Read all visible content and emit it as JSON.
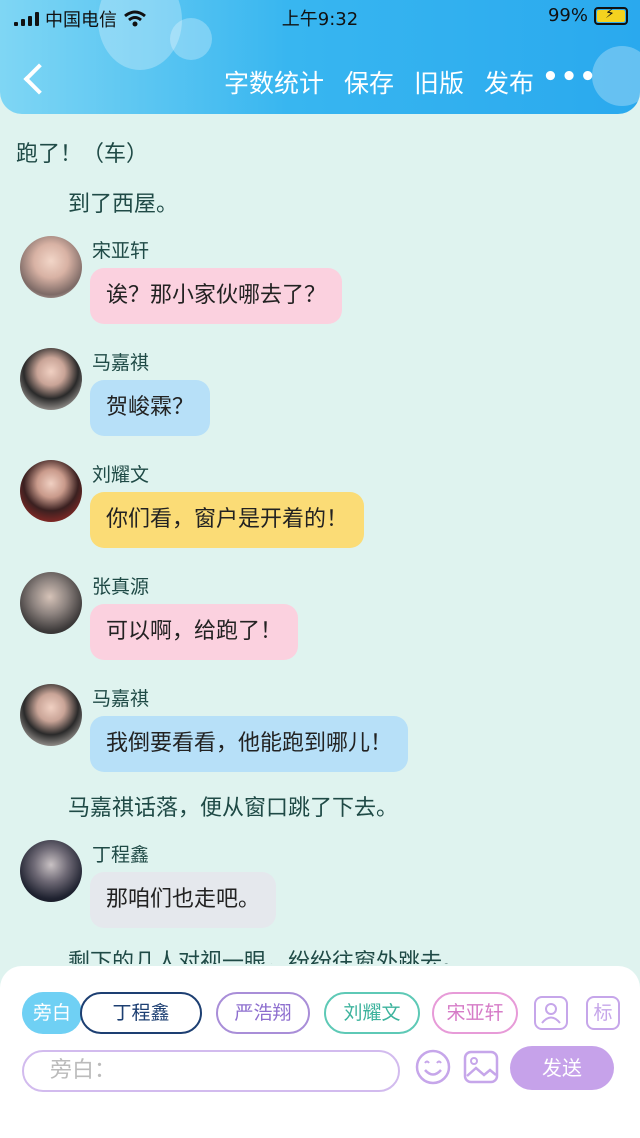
{
  "status_bar": {
    "carrier": "中国电信",
    "time": "上午9:32",
    "battery": "99%"
  },
  "nav": {
    "buttons": [
      "字数统计",
      "保存",
      "旧版",
      "发布"
    ],
    "more": "•••"
  },
  "chat": {
    "narration_top": "跑了！（车）",
    "narration_1": "到了西屋。",
    "messages": [
      {
        "name": "宋亚轩",
        "text": "诶？那小家伙哪去了？",
        "color": "#fbd1df"
      },
      {
        "name": "马嘉祺",
        "text": "贺峻霖？",
        "color": "#b7e0f8"
      },
      {
        "name": "刘耀文",
        "text": "你们看，窗户是开着的！",
        "color": "#fbdc76"
      },
      {
        "name": "张真源",
        "text": "可以啊，给跑了！",
        "color": "#fbd1df"
      },
      {
        "name": "马嘉祺",
        "text": "我倒要看看，他能跑到哪儿！",
        "color": "#b7e0f8"
      },
      {
        "name": "丁程鑫",
        "text": "那咱们也走吧。",
        "color": "#e5e8ed"
      }
    ],
    "narration_2": "马嘉祺话落，便从窗口跳了下去。",
    "narration_3": "剩下的几人对视一眼，纷纷往窗外跳去。"
  },
  "panel": {
    "chips": [
      "旁白",
      "丁程鑫",
      "严浩翔",
      "刘耀文",
      "宋亚轩"
    ],
    "icon_labels": [
      "标"
    ],
    "input_placeholder": "旁白：",
    "send": "发送"
  },
  "colors": {
    "accent": "#2aa9ee",
    "purple": "#c6a2ea"
  }
}
